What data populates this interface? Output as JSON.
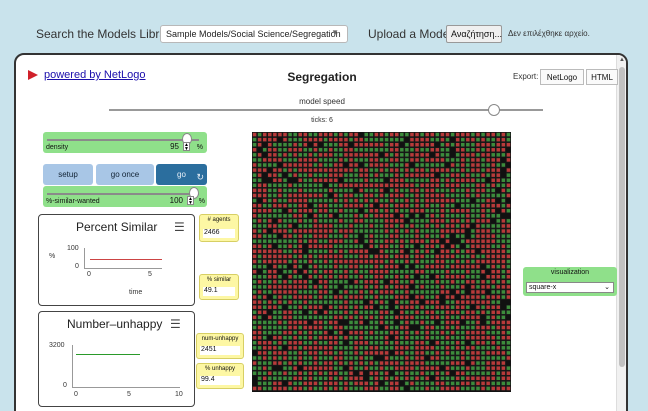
{
  "top": {
    "search_label": "Search the Models Library:",
    "model_select": "Sample Models/Social Science/Segregation",
    "upload_label": "Upload a Model:",
    "file_button": "Αναζήτηση...",
    "file_status": "Δεν επιλέχθηκε αρχείο."
  },
  "header": {
    "powered_by": "powered by NetLogo",
    "title": "Segregation",
    "export_label": "Export:",
    "export_netlogo": "NetLogo",
    "export_html": "HTML"
  },
  "speed": {
    "label": "model speed",
    "ticks_label": "ticks: 6",
    "value": 0.88
  },
  "sliders": {
    "density": {
      "name": "density",
      "value": "95",
      "unit": "%",
      "fraction": 0.95
    },
    "similar": {
      "name": "%-similar-wanted",
      "value": "100",
      "unit": "%",
      "fraction": 1.0
    }
  },
  "buttons": {
    "setup": "setup",
    "go_once": "go once",
    "go": "go"
  },
  "plots": {
    "percent_similar": {
      "title": "Percent Similar",
      "y_max": "100",
      "y_min": "0",
      "y_label": "%",
      "x_min": "0",
      "x_max": "5",
      "x_label": "time"
    },
    "number_unhappy": {
      "title": "Number–unhappy",
      "y_max": "3200",
      "y_min": "0",
      "x_min": "0",
      "x_mid": "5",
      "x_max": "10"
    }
  },
  "monitors": {
    "agents": {
      "name": "# agents",
      "value": "2466"
    },
    "similar": {
      "name": "% similar",
      "value": "49.1"
    },
    "num_unhappy": {
      "name": "num-unhappy",
      "value": "2451"
    },
    "pct_unhappy": {
      "name": "% unhappy",
      "value": "99.4"
    }
  },
  "chooser": {
    "name": "visualization",
    "value": "square-x"
  },
  "colors": {
    "red_agent": "#b83a3a",
    "green_agent": "#3c8c3c",
    "empty": "#111111",
    "slider_bg": "#8fe08a",
    "monitor_bg": "#fdf7a4"
  }
}
